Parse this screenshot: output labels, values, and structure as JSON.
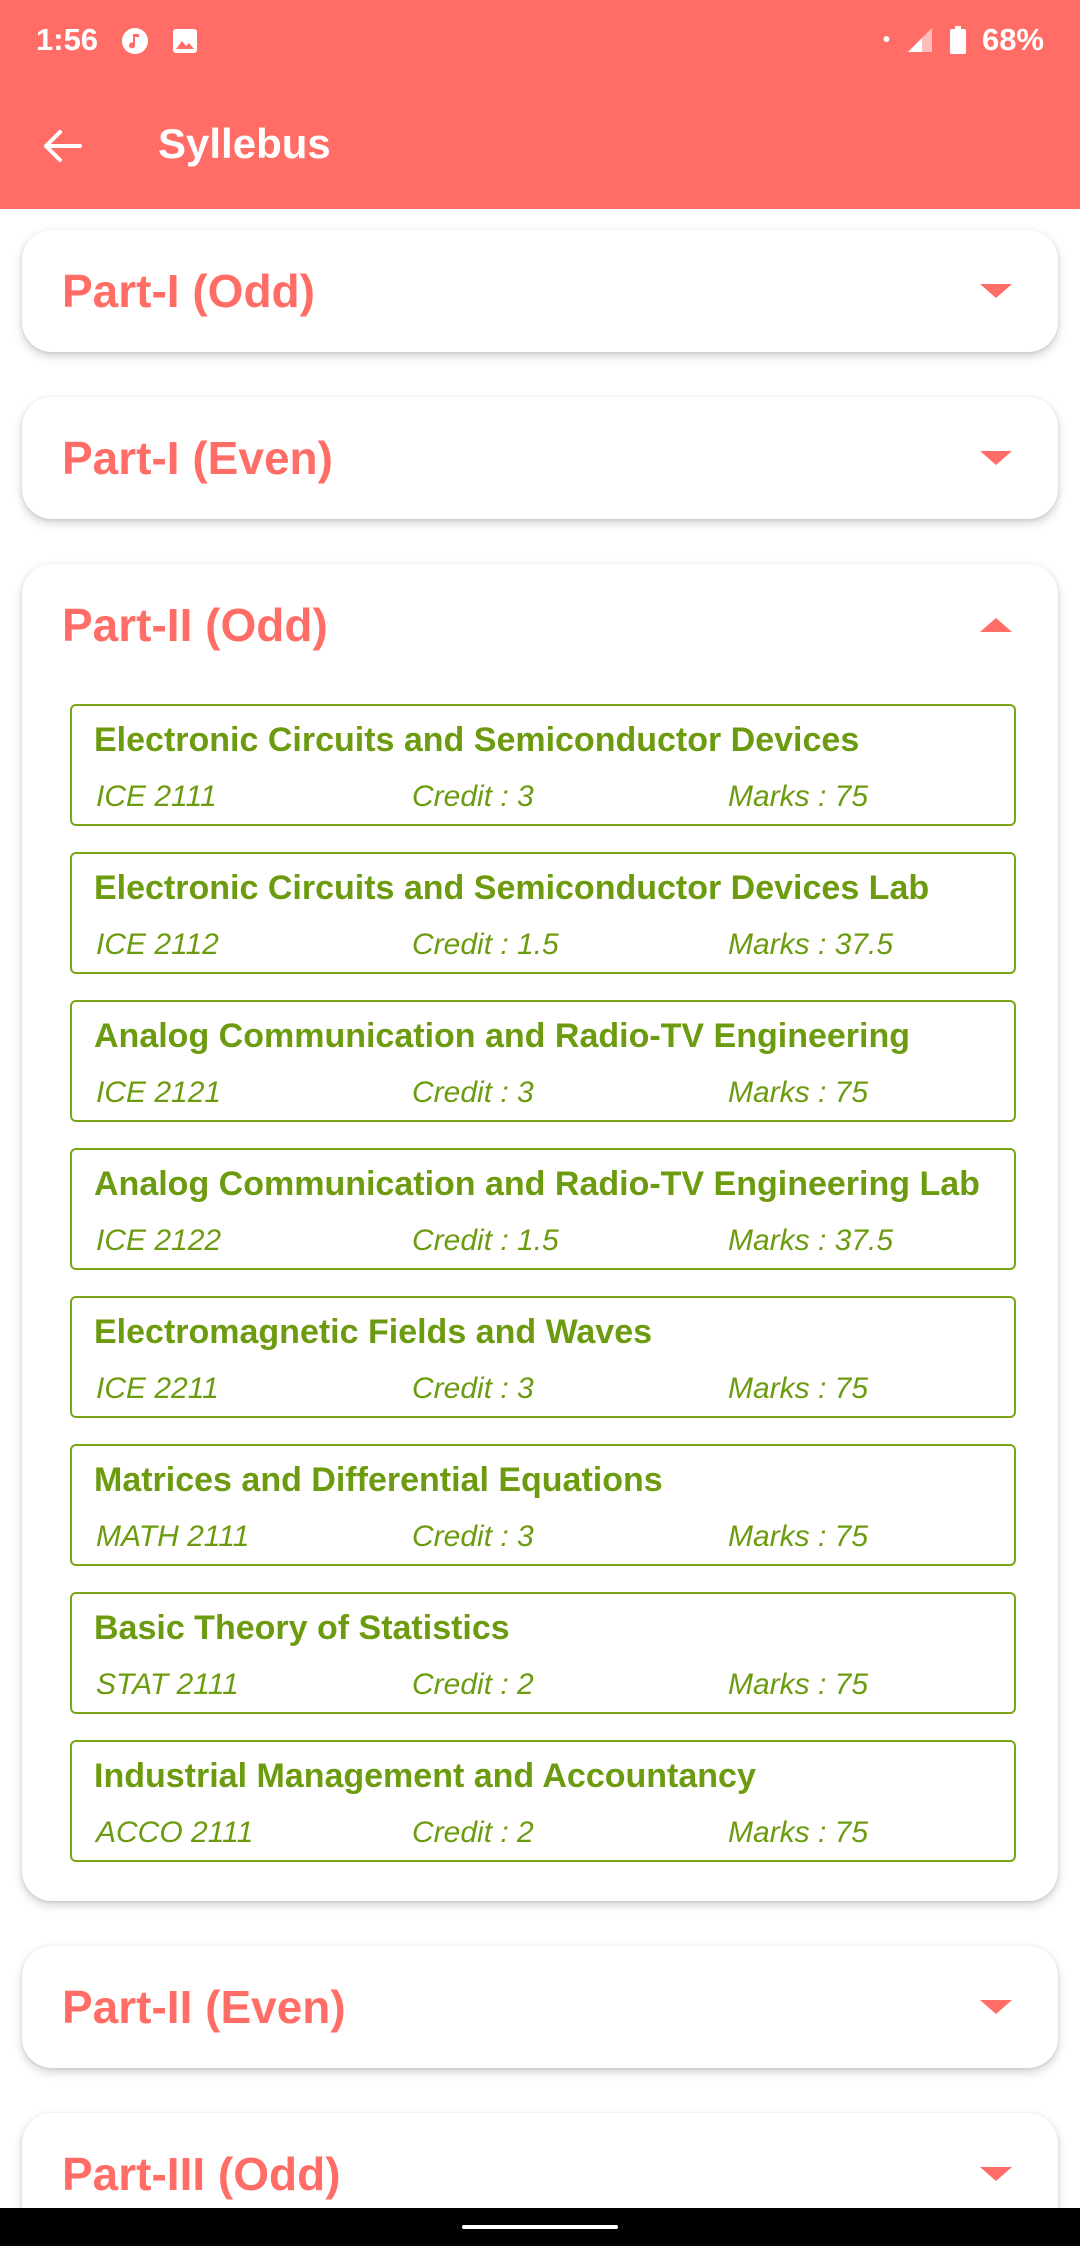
{
  "status_bar": {
    "time": "1:56",
    "battery": "68%",
    "icons": [
      "music-icon",
      "image-icon",
      "signal-icon",
      "battery-icon"
    ]
  },
  "app_bar": {
    "title": "Syllebus",
    "back_icon": "arrow-left-icon"
  },
  "sections": [
    {
      "title": "Part-I (Odd)",
      "expanded": false
    },
    {
      "title": "Part-I (Even)",
      "expanded": false
    },
    {
      "title": "Part-II (Odd)",
      "expanded": true
    },
    {
      "title": "Part-II (Even)",
      "expanded": false
    },
    {
      "title": "Part-III (Odd)",
      "expanded": false
    }
  ],
  "courses": [
    {
      "name": "Electronic Circuits and Semiconductor Devices",
      "code": "ICE 2111",
      "credit": "Credit : 3",
      "marks": "Marks : 75"
    },
    {
      "name": "Electronic Circuits and Semiconductor Devices Lab",
      "code": "ICE 2112",
      "credit": "Credit : 1.5",
      "marks": "Marks : 37.5"
    },
    {
      "name": "Analog Communication and Radio-TV Engineering",
      "code": "ICE 2121",
      "credit": "Credit : 3",
      "marks": "Marks : 75"
    },
    {
      "name": "Analog Communication and Radio-TV Engineering Lab",
      "code": "ICE 2122",
      "credit": "Credit : 1.5",
      "marks": "Marks : 37.5"
    },
    {
      "name": "Electromagnetic Fields and Waves",
      "code": "ICE 2211",
      "credit": "Credit : 3",
      "marks": "Marks : 75"
    },
    {
      "name": "Matrices and Differential Equations",
      "code": "MATH 2111",
      "credit": "Credit : 3",
      "marks": "Marks : 75"
    },
    {
      "name": "Basic Theory of Statistics",
      "code": "STAT 2111",
      "credit": "Credit : 2",
      "marks": "Marks : 75"
    },
    {
      "name": "Industrial Management and Accountancy",
      "code": "ACCO 2111",
      "credit": "Credit : 2",
      "marks": "Marks : 75"
    }
  ],
  "colors": {
    "accent": "#ff6d66",
    "course_green": "#6c9b10",
    "course_border": "#7aa718"
  }
}
